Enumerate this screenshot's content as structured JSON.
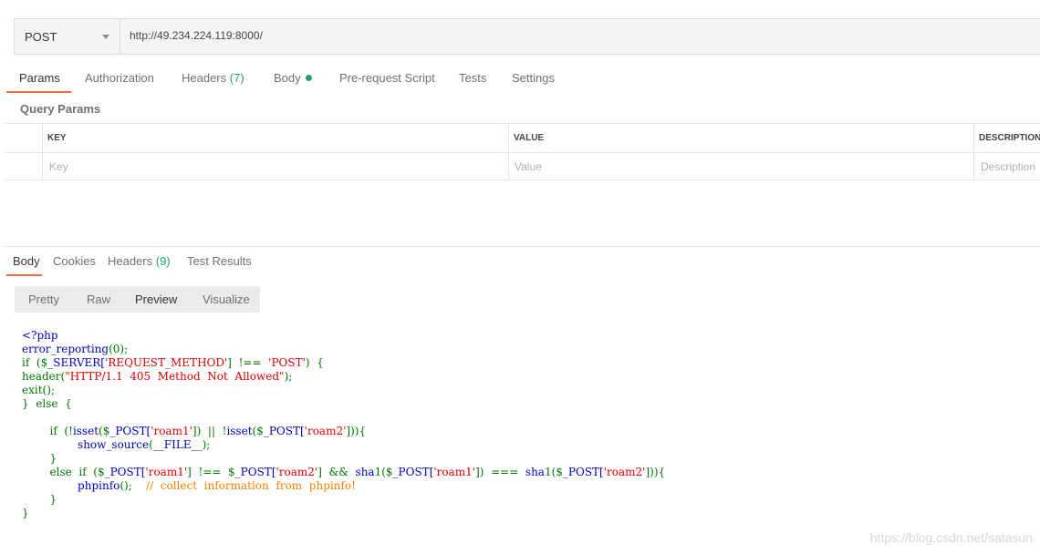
{
  "request": {
    "method": "POST",
    "url": "http://49.234.224.119:8000/"
  },
  "request_tabs": [
    {
      "label": "Params",
      "active": true
    },
    {
      "label": "Authorization"
    },
    {
      "label": "Headers",
      "count": "(7)"
    },
    {
      "label": "Body",
      "has_dot": true
    },
    {
      "label": "Pre-request Script"
    },
    {
      "label": "Tests"
    },
    {
      "label": "Settings"
    }
  ],
  "query_params": {
    "title": "Query Params",
    "columns": [
      "KEY",
      "VALUE",
      "DESCRIPTION"
    ],
    "placeholders": [
      "Key",
      "Value",
      "Description"
    ]
  },
  "response_tabs": [
    {
      "label": "Body",
      "active": true
    },
    {
      "label": "Cookies"
    },
    {
      "label": "Headers",
      "count": "(9)"
    },
    {
      "label": "Test Results"
    }
  ],
  "view_modes": [
    {
      "label": "Pretty"
    },
    {
      "label": "Raw"
    },
    {
      "label": "Preview",
      "active": true
    },
    {
      "label": "Visualize"
    }
  ],
  "response_code": {
    "lines": [
      "<?php",
      "error_reporting(0);",
      "if  ($_SERVER['REQUEST_METHOD']  !==  'POST')  {",
      "header(\"HTTP/1.1  405  Method  Not  Allowed\");",
      "exit();",
      "}  else  {",
      "",
      "        if  (!isset($_POST['roam1'])  ||  !isset($_POST['roam2'])){",
      "                show_source(__FILE__);",
      "        }",
      "        else  if  ($_POST['roam1']  !==  $_POST['roam2']  &&  sha1($_POST['roam1'])  ===  sha1($_POST['roam2'])){",
      "                phpinfo();    //  collect  information  from  phpinfo!",
      "        }",
      "}"
    ]
  },
  "watermark": "https://blog.csdn.net/satasun",
  "colors": {
    "accent": "#f26b3a",
    "badge_green": "#26a060",
    "php_default": "#0000BB",
    "php_keyword": "#007700",
    "php_string": "#DD0000",
    "php_comment": "#FF8000"
  }
}
